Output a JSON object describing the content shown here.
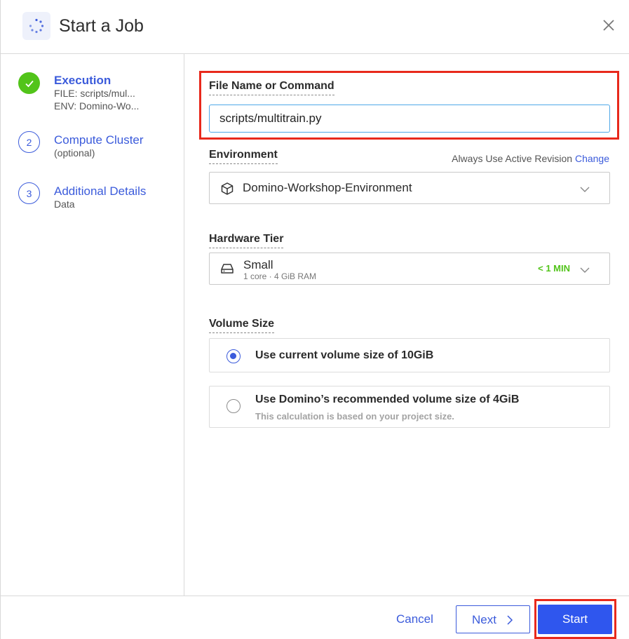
{
  "header": {
    "title": "Start a Job",
    "icon": "spinner-icon",
    "close_icon": "close-icon"
  },
  "steps": [
    {
      "title": "Execution",
      "lines": [
        "FILE: scripts/mul...",
        "ENV: Domino-Wo..."
      ],
      "state": "complete"
    },
    {
      "number": "2",
      "title": "Compute Cluster",
      "lines": [
        "(optional)"
      ],
      "state": "pending"
    },
    {
      "number": "3",
      "title": "Additional Details",
      "lines": [
        "Data"
      ],
      "state": "pending"
    }
  ],
  "file": {
    "label": "File Name or Command",
    "value": "scripts/multitrain.py"
  },
  "environment": {
    "label": "Environment",
    "revision_text": "Always Use Active Revision",
    "change_link": "Change",
    "selected": "Domino-Workshop-Environment",
    "icon": "box-icon"
  },
  "hardware": {
    "label": "Hardware Tier",
    "name": "Small",
    "specs": "1 core · 4 GiB RAM",
    "wait": "< 1 MIN",
    "icon": "hard-drive-icon"
  },
  "volume": {
    "label": "Volume Size",
    "options": [
      {
        "label": "Use current volume size of 10GiB",
        "selected": true
      },
      {
        "label": "Use Domino’s recommended volume size of 4GiB",
        "note": "This calculation is based on your project size.",
        "selected": false
      }
    ]
  },
  "footer": {
    "cancel": "Cancel",
    "next": "Next",
    "start": "Start"
  },
  "colors": {
    "accent": "#3b5bdb",
    "primary_button": "#2f56ee",
    "success": "#52c41a",
    "highlight": "#e8291c"
  }
}
